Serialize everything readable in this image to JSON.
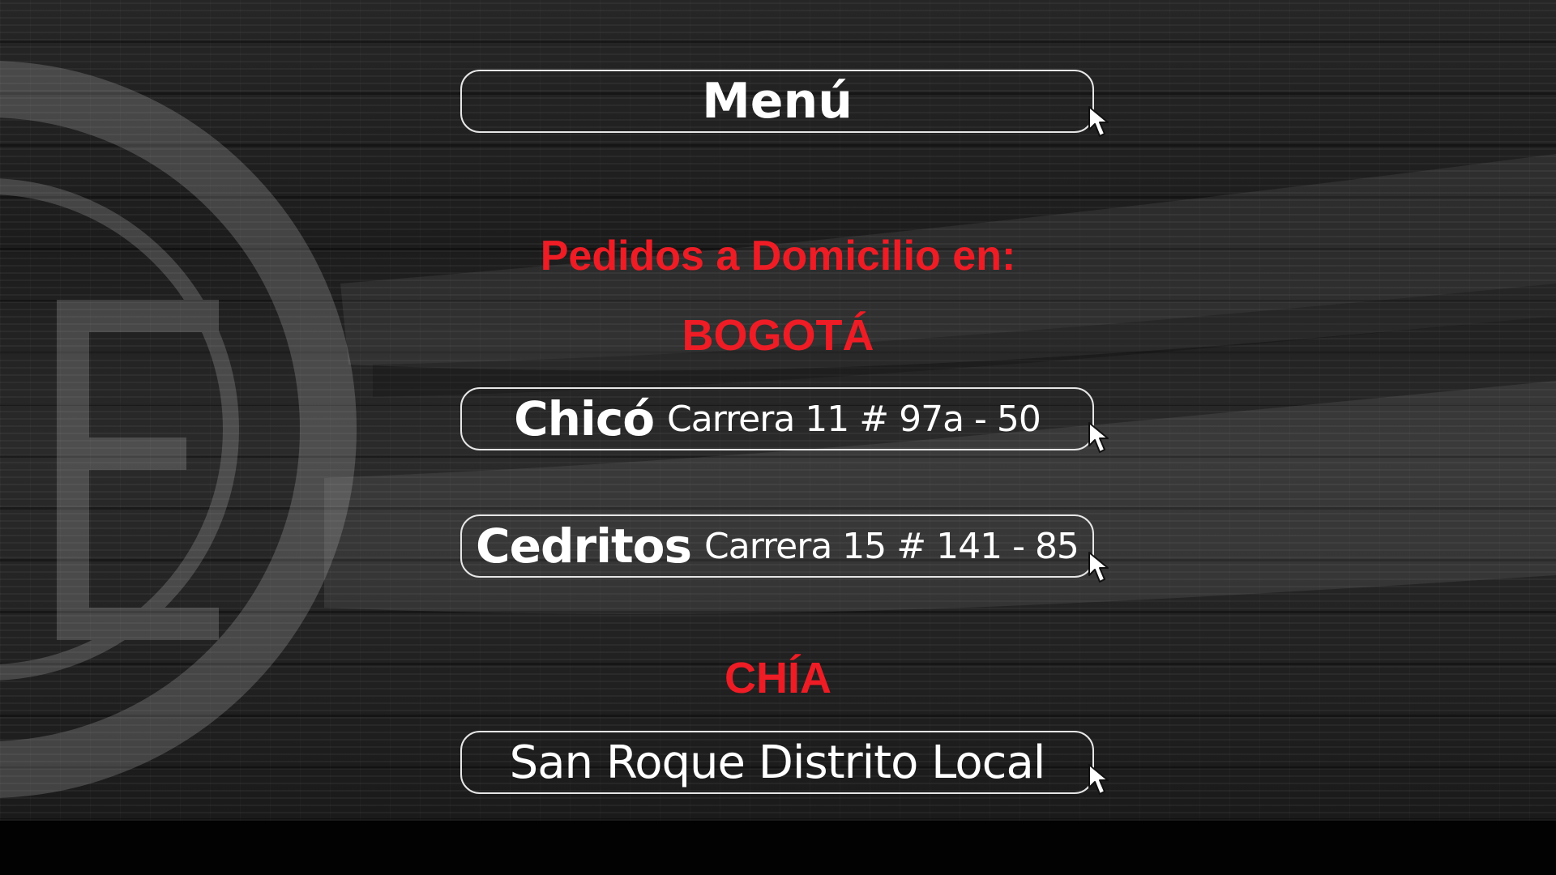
{
  "menu": {
    "label": "Menú"
  },
  "delivery": {
    "title": "Pedidos a Domicilio en:",
    "cities": [
      {
        "name": "BOGOTÁ",
        "locations": [
          {
            "name": "Chicó",
            "address": "Carrera 11 # 97a - 50"
          },
          {
            "name": "Cedritos",
            "address": "Carrera 15 # 141 - 85"
          }
        ]
      },
      {
        "name": "CHÍA",
        "locations": [
          {
            "name": "San Roque Distrito Local"
          }
        ]
      }
    ]
  },
  "colors": {
    "accent": "#ee1c25",
    "button_border": "#e6e6e6",
    "text": "#ffffff",
    "background": "#1f1f1f"
  },
  "icons": [
    "cursor-arrow-icon"
  ]
}
